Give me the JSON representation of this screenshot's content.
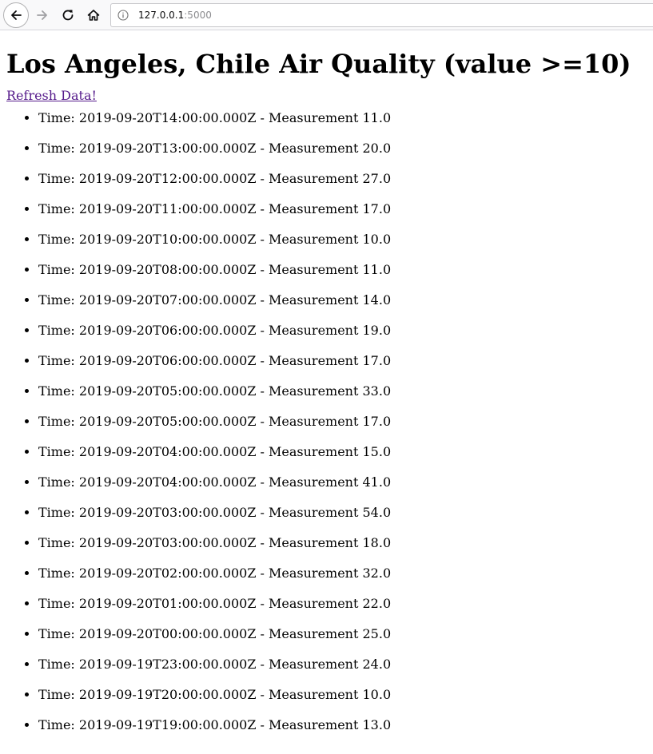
{
  "browser": {
    "url_host": "127.0.0.1",
    "url_port": ":5000"
  },
  "page": {
    "title": "Los Angeles, Chile Air Quality (value >=10)",
    "refresh_label": "Refresh Data!",
    "time_prefix": "Time: ",
    "measurement_separator": " - Measurement ",
    "measurements": [
      {
        "time": "2019-09-20T14:00:00.000Z",
        "value": "11.0"
      },
      {
        "time": "2019-09-20T13:00:00.000Z",
        "value": "20.0"
      },
      {
        "time": "2019-09-20T12:00:00.000Z",
        "value": "27.0"
      },
      {
        "time": "2019-09-20T11:00:00.000Z",
        "value": "17.0"
      },
      {
        "time": "2019-09-20T10:00:00.000Z",
        "value": "10.0"
      },
      {
        "time": "2019-09-20T08:00:00.000Z",
        "value": "11.0"
      },
      {
        "time": "2019-09-20T07:00:00.000Z",
        "value": "14.0"
      },
      {
        "time": "2019-09-20T06:00:00.000Z",
        "value": "19.0"
      },
      {
        "time": "2019-09-20T06:00:00.000Z",
        "value": "17.0"
      },
      {
        "time": "2019-09-20T05:00:00.000Z",
        "value": "33.0"
      },
      {
        "time": "2019-09-20T05:00:00.000Z",
        "value": "17.0"
      },
      {
        "time": "2019-09-20T04:00:00.000Z",
        "value": "15.0"
      },
      {
        "time": "2019-09-20T04:00:00.000Z",
        "value": "41.0"
      },
      {
        "time": "2019-09-20T03:00:00.000Z",
        "value": "54.0"
      },
      {
        "time": "2019-09-20T03:00:00.000Z",
        "value": "18.0"
      },
      {
        "time": "2019-09-20T02:00:00.000Z",
        "value": "32.0"
      },
      {
        "time": "2019-09-20T01:00:00.000Z",
        "value": "22.0"
      },
      {
        "time": "2019-09-20T00:00:00.000Z",
        "value": "25.0"
      },
      {
        "time": "2019-09-19T23:00:00.000Z",
        "value": "24.0"
      },
      {
        "time": "2019-09-19T20:00:00.000Z",
        "value": "10.0"
      },
      {
        "time": "2019-09-19T19:00:00.000Z",
        "value": "13.0"
      }
    ]
  }
}
